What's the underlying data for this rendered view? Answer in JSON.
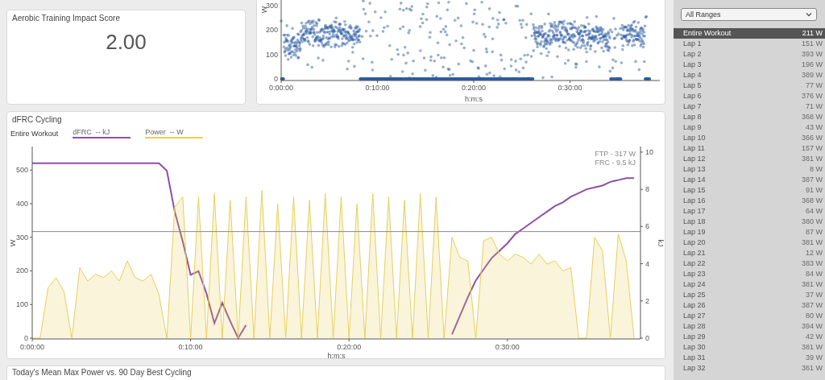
{
  "scatter_panel": {
    "y_label": "W",
    "x_label": "h:m:s",
    "yticks": [
      "300",
      "200",
      "100",
      "0"
    ],
    "xticks": [
      "0:00:00",
      "0:10:00",
      "0:20:00",
      "0:30:00"
    ]
  },
  "score_card": {
    "title": "Aerobic Training Impact Score",
    "value": "2.00"
  },
  "dfrc_card": {
    "title": "dFRC Cycling",
    "range_label": "Entire Workout",
    "chart_data": {
      "type": "line",
      "xlabel": "h:m:s",
      "ylabel": "W",
      "y2label": "kJ",
      "x": [
        0,
        0.5,
        1,
        1.5,
        2,
        2.5,
        3,
        3.5,
        4,
        4.5,
        5,
        5.5,
        6,
        6.5,
        7,
        7.5,
        8,
        8.5,
        9,
        9.5,
        10,
        10.5,
        11,
        11.5,
        12,
        12.5,
        13,
        13.5,
        14,
        14.5,
        15,
        15.5,
        16,
        16.5,
        17,
        17.5,
        18,
        18.5,
        19,
        19.5,
        20,
        20.5,
        21,
        21.5,
        22,
        22.5,
        23,
        23.5,
        24,
        24.5,
        25,
        25.5,
        26,
        26.5,
        27,
        27.5,
        28,
        28.5,
        29,
        29.5,
        30,
        30.5,
        31,
        31.5,
        32,
        32.5,
        33,
        33.5,
        34,
        34.5,
        35,
        35.5,
        36,
        36.5,
        37,
        37.5,
        38
      ],
      "series": [
        {
          "name": "dFRC  -- kJ",
          "axis": "y2",
          "color": "#8e4fa3",
          "values": [
            9.4,
            9.4,
            9.4,
            9.4,
            9.4,
            9.4,
            9.4,
            9.4,
            9.4,
            9.4,
            9.4,
            9.4,
            9.4,
            9.4,
            9.4,
            9.4,
            9.4,
            9.0,
            6.8,
            5.2,
            3.4,
            3.6,
            2.4,
            0.8,
            1.9,
            0.9,
            0,
            0.7,
            null,
            null,
            null,
            null,
            null,
            null,
            null,
            null,
            null,
            null,
            null,
            null,
            null,
            null,
            null,
            null,
            null,
            null,
            null,
            null,
            null,
            null,
            null,
            null,
            null,
            0.2,
            1.2,
            2.2,
            3.1,
            3.7,
            4.3,
            4.7,
            5.1,
            5.6,
            5.9,
            6.2,
            6.5,
            6.8,
            7.1,
            7.3,
            7.6,
            7.8,
            8.0,
            8.1,
            8.2,
            8.4,
            8.5,
            8.6,
            8.6
          ]
        },
        {
          "name": "Power  -- W",
          "color": "#e8cf5a",
          "values": [
            0,
            0,
            150,
            180,
            140,
            0,
            210,
            170,
            190,
            180,
            200,
            170,
            230,
            180,
            170,
            190,
            130,
            0,
            390,
            420,
            0,
            420,
            0,
            430,
            0,
            410,
            0,
            420,
            0,
            440,
            0,
            400,
            0,
            420,
            0,
            410,
            0,
            430,
            0,
            420,
            0,
            400,
            0,
            430,
            0,
            420,
            0,
            410,
            0,
            430,
            0,
            420,
            0,
            300,
            240,
            230,
            0,
            290,
            300,
            250,
            230,
            250,
            240,
            220,
            250,
            220,
            230,
            200,
            210,
            0,
            0,
            300,
            260,
            0,
            310,
            230,
            0
          ]
        }
      ],
      "xlim": [
        0,
        38.3
      ],
      "ylim": [
        0,
        570
      ],
      "y2lim": [
        0,
        10.3
      ],
      "xticks": [
        {
          "value": 0,
          "label": "0:00:00"
        },
        {
          "value": 10,
          "label": "0:10:00"
        },
        {
          "value": 20,
          "label": "0:20:00"
        },
        {
          "value": 30,
          "label": "0:30:00"
        }
      ],
      "yticks": [
        0,
        100,
        200,
        300,
        400,
        500
      ],
      "y2ticks": [
        0,
        2,
        4,
        6,
        8,
        10
      ],
      "ref_lines": [
        {
          "axis": "y",
          "value": 317
        }
      ],
      "annotations": [
        {
          "text": "FTP - 317 W"
        },
        {
          "text": "FRC - 9.5 kJ"
        }
      ]
    }
  },
  "bottom_card": {
    "title": "Today's Mean Max Power vs. 90 Day Best Cycling"
  },
  "sidebar": {
    "range_select": {
      "value": "All Ranges"
    },
    "laps": [
      {
        "label": "Entire Workout",
        "value": "211 W",
        "selected": true
      },
      {
        "label": "Lap 1",
        "value": "151 W",
        "selected": false
      },
      {
        "label": "Lap 2",
        "value": "393 W",
        "selected": false
      },
      {
        "label": "Lap 3",
        "value": "196 W",
        "selected": false
      },
      {
        "label": "Lap 4",
        "value": "389 W",
        "selected": false
      },
      {
        "label": "Lap 5",
        "value": "77 W",
        "selected": false
      },
      {
        "label": "Lap 6",
        "value": "376 W",
        "selected": false
      },
      {
        "label": "Lap 7",
        "value": "71 W",
        "selected": false
      },
      {
        "label": "Lap 8",
        "value": "368 W",
        "selected": false
      },
      {
        "label": "Lap 9",
        "value": "43 W",
        "selected": false
      },
      {
        "label": "Lap 10",
        "value": "366 W",
        "selected": false
      },
      {
        "label": "Lap 11",
        "value": "157 W",
        "selected": false
      },
      {
        "label": "Lap 12",
        "value": "381 W",
        "selected": false
      },
      {
        "label": "Lap 13",
        "value": "8 W",
        "selected": false
      },
      {
        "label": "Lap 14",
        "value": "387 W",
        "selected": false
      },
      {
        "label": "Lap 15",
        "value": "91 W",
        "selected": false
      },
      {
        "label": "Lap 16",
        "value": "368 W",
        "selected": false
      },
      {
        "label": "Lap 17",
        "value": "64 W",
        "selected": false
      },
      {
        "label": "Lap 18",
        "value": "380 W",
        "selected": false
      },
      {
        "label": "Lap 19",
        "value": "87 W",
        "selected": false
      },
      {
        "label": "Lap 20",
        "value": "381 W",
        "selected": false
      },
      {
        "label": "Lap 21",
        "value": "12 W",
        "selected": false
      },
      {
        "label": "Lap 22",
        "value": "383 W",
        "selected": false
      },
      {
        "label": "Lap 23",
        "value": "84 W",
        "selected": false
      },
      {
        "label": "Lap 24",
        "value": "381 W",
        "selected": false
      },
      {
        "label": "Lap 25",
        "value": "37 W",
        "selected": false
      },
      {
        "label": "Lap 26",
        "value": "387 W",
        "selected": false
      },
      {
        "label": "Lap 27",
        "value": "80 W",
        "selected": false
      },
      {
        "label": "Lap 28",
        "value": "394 W",
        "selected": false
      },
      {
        "label": "Lap 29",
        "value": "42 W",
        "selected": false
      },
      {
        "label": "Lap 30",
        "value": "381 W",
        "selected": false
      },
      {
        "label": "Lap 31",
        "value": "39 W",
        "selected": false
      },
      {
        "label": "Lap 32",
        "value": "361 W",
        "selected": false
      }
    ]
  }
}
